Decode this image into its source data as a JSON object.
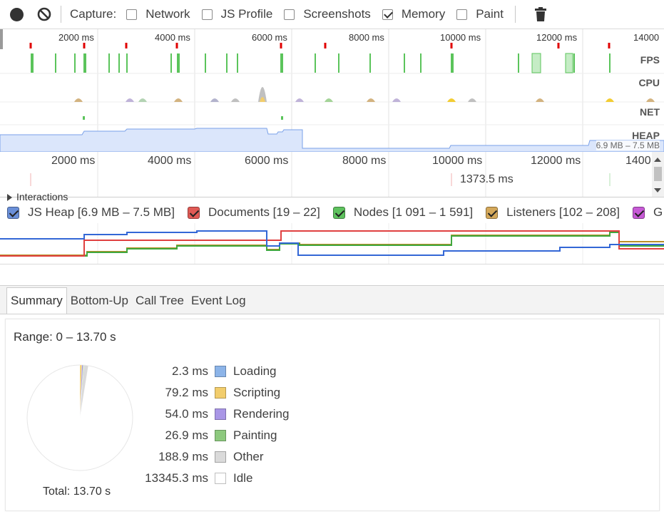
{
  "toolbar": {
    "capture_label": "Capture:",
    "options": [
      {
        "label": "Network",
        "checked": false
      },
      {
        "label": "JS Profile",
        "checked": false
      },
      {
        "label": "Screenshots",
        "checked": false
      },
      {
        "label": "Memory",
        "checked": true
      },
      {
        "label": "Paint",
        "checked": false
      }
    ]
  },
  "overview": {
    "ticks": [
      "2000 ms",
      "4000 ms",
      "6000 ms",
      "8000 ms",
      "10000 ms",
      "12000 ms",
      "14000"
    ],
    "tracks": {
      "fps": "FPS",
      "cpu": "CPU",
      "net": "NET",
      "heap": "HEAP"
    },
    "heap_range": "6.9 MB – 7.5 MB"
  },
  "detail": {
    "ticks": [
      "2000 ms",
      "4000 ms",
      "6000 ms",
      "8000 ms",
      "10000 ms",
      "12000 ms",
      "1400"
    ],
    "marker": "1373.5 ms",
    "interactions_label": "Interactions"
  },
  "legend": [
    {
      "label": "JS Heap [6.9 MB – 7.5 MB]",
      "color": "#6a8fd8"
    },
    {
      "label": "Documents [19 – 22]",
      "color": "#e05a55"
    },
    {
      "label": "Nodes [1 091 – 1 591]",
      "color": "#5ec25e"
    },
    {
      "label": "Listeners [102 – 208]",
      "color": "#d4a85a"
    },
    {
      "label": "G",
      "color": "#c75ad6"
    }
  ],
  "tabs": [
    "Summary",
    "Bottom-Up",
    "Call Tree",
    "Event Log"
  ],
  "summary": {
    "range": "Range: 0 – 13.70 s",
    "total": "Total: 13.70 s",
    "categories": [
      {
        "value": "2.3 ms",
        "name": "Loading",
        "color": "#8cb4e8"
      },
      {
        "value": "79.2 ms",
        "name": "Scripting",
        "color": "#f2cd6c"
      },
      {
        "value": "54.0 ms",
        "name": "Rendering",
        "color": "#a996e6"
      },
      {
        "value": "26.9 ms",
        "name": "Painting",
        "color": "#8dc97e"
      },
      {
        "value": "188.9 ms",
        "name": "Other",
        "color": "#dadada"
      },
      {
        "value": "13345.3 ms",
        "name": "Idle",
        "color": "#ffffff"
      }
    ]
  },
  "colors": {
    "jsheap": "#3367d6",
    "documents": "#e04040",
    "nodes": "#40a840",
    "listeners": "#b89028"
  }
}
